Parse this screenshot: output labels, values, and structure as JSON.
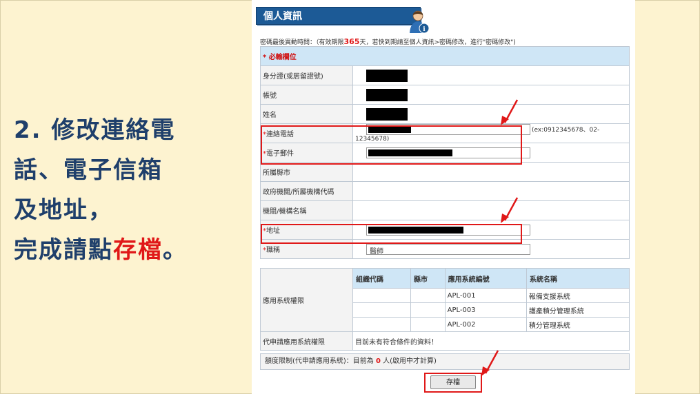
{
  "instruction": {
    "line1": "2. 修改連絡電",
    "line2": "話、電子信箱",
    "line3": "及地址，",
    "line4_prefix": "完成請點",
    "line4_highlight": "存檔",
    "line4_suffix": "。"
  },
  "header": {
    "title": "個人資訊",
    "icon": "user-info-icon"
  },
  "password_note": {
    "prefix": "密碼最後異動時間：（有效期限",
    "days": "365",
    "suffix": "天，若快到期請至個人資訊>密碼修改，進行\"密碼修改\")"
  },
  "form": {
    "required_heading": "必輸欄位",
    "required_mark": "*",
    "fields": {
      "id_number": "身分證(或居留證號)",
      "account": "帳號",
      "name": "姓名",
      "phone": "連絡電話",
      "phone_example": "(ex:0912345678、02-12345678)",
      "email": "電子郵件",
      "county": "所屬縣市",
      "org_code": "政府機關/所屬機構代碼",
      "org_name": "機關/機構名稱",
      "address": "地址",
      "job_title": "職稱",
      "job_title_value": "醫師"
    }
  },
  "permissions": {
    "label": "應用系統權限",
    "headers": [
      "組織代碼",
      "縣市",
      "應用系統編號",
      "系統名稱"
    ],
    "rows": [
      {
        "code": "APL-001",
        "name": "報備支援系統"
      },
      {
        "code": "APL-003",
        "name": "護產積分管理系統"
      },
      {
        "code": "APL-002",
        "name": "積分管理系統"
      }
    ],
    "proxy_label": "代申請應用系統權限",
    "proxy_value": "目前未有符合條件的資料！"
  },
  "quota": {
    "prefix": "額度限制(代申請應用系統)：目前為",
    "count": "0",
    "suffix": "人(啟用中才計算)"
  },
  "save_button": "存檔",
  "colors": {
    "accent_red": "#e01818",
    "header_blue": "#1c5a96",
    "label_blue": "#cfe6f6"
  }
}
